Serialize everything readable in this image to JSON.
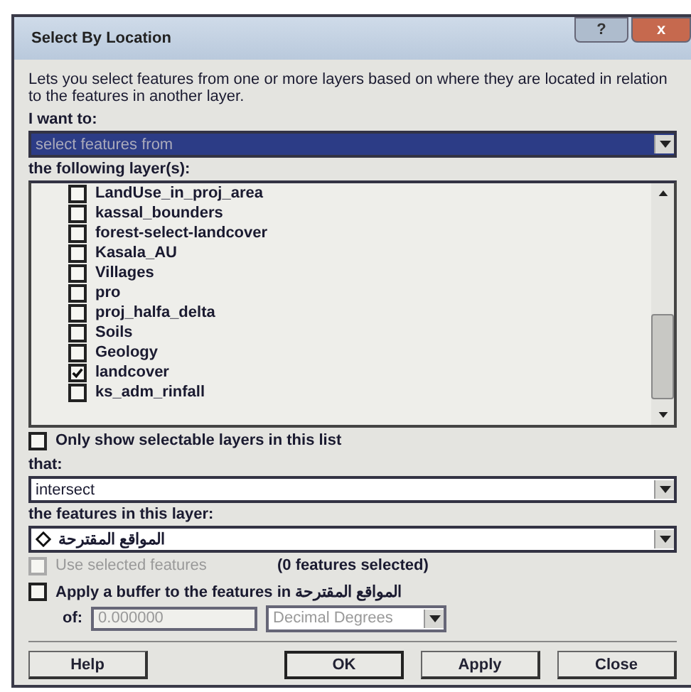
{
  "window": {
    "title": "Select By Location",
    "help_button": "?",
    "close_button": "x"
  },
  "description": "Lets you select features from one or more layers based on where they are located in relation to the features in another layer.",
  "method": {
    "label": "I want to:",
    "value": "select features from",
    "selected": true
  },
  "layers": {
    "label": "the following layer(s):",
    "items": [
      {
        "name": "LandUse_in_proj_area",
        "checked": false
      },
      {
        "name": "kassal_bounders",
        "checked": false
      },
      {
        "name": "forest-select-landcover",
        "checked": false
      },
      {
        "name": "Kasala_AU",
        "checked": false
      },
      {
        "name": "Villages",
        "checked": false
      },
      {
        "name": "pro",
        "checked": false
      },
      {
        "name": "proj_halfa_delta",
        "checked": false
      },
      {
        "name": "Soils",
        "checked": false
      },
      {
        "name": "Geology",
        "checked": false
      },
      {
        "name": "landcover",
        "checked": true
      },
      {
        "name": "ks_adm_rinfall",
        "checked": false
      }
    ]
  },
  "only_selectable": {
    "label": "Only show selectable layers in this list",
    "checked": false
  },
  "relation": {
    "label": "that:",
    "value": "intersect"
  },
  "source_layer": {
    "label": "the features in this layer:",
    "value": "المواقع المقترحة"
  },
  "use_selected": {
    "label": "Use selected features",
    "checked": false,
    "disabled": true,
    "count": "(0 features selected)"
  },
  "buffer": {
    "label": "Apply a buffer to the features in المواقع المقترحة",
    "checked": false,
    "of_label": "of:",
    "distance": "0.000000",
    "units": "Decimal Degrees",
    "disabled": true
  },
  "buttons": [
    {
      "label": "Help",
      "default": false
    },
    {
      "label": "OK",
      "default": true
    },
    {
      "label": "Apply",
      "default": false
    },
    {
      "label": "Close",
      "default": false
    }
  ]
}
